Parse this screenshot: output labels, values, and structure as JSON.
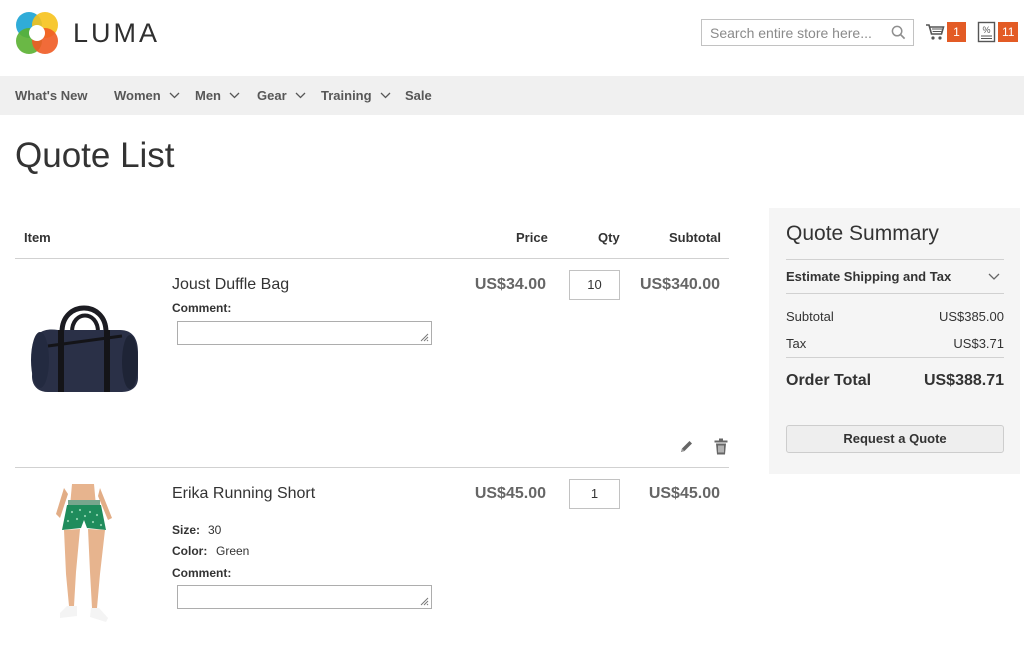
{
  "brand": {
    "name": "LUMA"
  },
  "search": {
    "placeholder": "Search entire store here..."
  },
  "header": {
    "cart_count": "1",
    "quote_count": "11"
  },
  "nav": [
    {
      "label": "What's New",
      "has_dropdown": false
    },
    {
      "label": "Women",
      "has_dropdown": true
    },
    {
      "label": "Men",
      "has_dropdown": true
    },
    {
      "label": "Gear",
      "has_dropdown": true
    },
    {
      "label": "Training",
      "has_dropdown": true
    },
    {
      "label": "Sale",
      "has_dropdown": false
    }
  ],
  "page": {
    "title": "Quote List"
  },
  "table": {
    "headers": {
      "item": "Item",
      "price": "Price",
      "qty": "Qty",
      "subtotal": "Subtotal"
    },
    "items": [
      {
        "name": "Joust Duffle Bag",
        "price": "US$34.00",
        "qty": "10",
        "subtotal": "US$340.00",
        "comment_label": "Comment:",
        "comment": "",
        "image_icon": "duffle-bag-image"
      },
      {
        "name": "Erika Running Short",
        "price": "US$45.00",
        "qty": "1",
        "subtotal": "US$45.00",
        "options": [
          {
            "label": "Size:",
            "value": "30"
          },
          {
            "label": "Color:",
            "value": "Green"
          }
        ],
        "comment_label": "Comment:",
        "comment": "",
        "image_icon": "running-short-image"
      }
    ]
  },
  "summary": {
    "title": "Quote Summary",
    "estimate_label": "Estimate Shipping and Tax",
    "subtotal_label": "Subtotal",
    "subtotal_value": "US$385.00",
    "tax_label": "Tax",
    "tax_value": "US$3.71",
    "total_label": "Order Total",
    "total_value": "US$388.71",
    "button_label": "Request a Quote"
  },
  "colors": {
    "accent": "#e35b25",
    "nav_bg": "#f0f0f0",
    "summary_bg": "#f5f5f5"
  }
}
